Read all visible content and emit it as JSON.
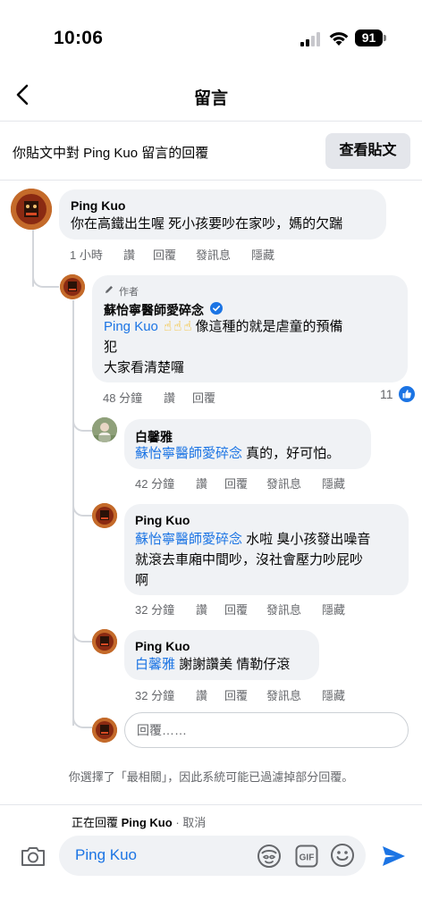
{
  "status": {
    "time": "10:06",
    "battery": "91"
  },
  "header": {
    "title": "留言"
  },
  "context": {
    "text": "你貼文中對 Ping Kuo 留言的回覆",
    "view_post": "查看貼文"
  },
  "comments": {
    "c1": {
      "name": "Ping Kuo",
      "text": "你在高鐵出生喔 死小孩要吵在家吵，媽的欠踹",
      "time": "1 小時",
      "like": "讚",
      "reply": "回覆",
      "message": "發訊息",
      "hide": "隱藏"
    },
    "c2": {
      "badge": "作者",
      "name": "蘇怡寧醫師愛碎念",
      "mention": "Ping Kuo",
      "emoji": "☝☝☝",
      "text_a": "像這種的就是虐童的預備",
      "text_b": "犯",
      "text_c": "大家看清楚囉",
      "time": "48 分鐘",
      "like": "讚",
      "reply": "回覆",
      "reactions": "11"
    },
    "c3": {
      "name": "白馨雅",
      "mention": "蘇怡寧醫師愛碎念",
      "text": " 真的，好可怕。",
      "time": "42 分鐘",
      "like": "讚",
      "reply": "回覆",
      "message": "發訊息",
      "hide": "隱藏"
    },
    "c4": {
      "name": "Ping Kuo",
      "mention": "蘇怡寧醫師愛碎念",
      "text_a": " 水啦 臭小孩發出噪音",
      "text_b": "就滾去車廂中間吵，沒社會壓力吵屁吵",
      "text_c": "啊",
      "time": "32 分鐘",
      "like": "讚",
      "reply": "回覆",
      "message": "發訊息",
      "hide": "隱藏"
    },
    "c5": {
      "name": "Ping Kuo",
      "mention": "白馨雅",
      "text": " 謝謝讚美 情勒仔滾",
      "time": "32 分鐘",
      "like": "讚",
      "reply": "回覆",
      "message": "發訊息",
      "hide": "隱藏"
    }
  },
  "reply_box": {
    "placeholder": "回覆……"
  },
  "notice": "你選擇了「最相關」，因此系統可能已過濾掉部分回覆。",
  "composer": {
    "replying_prefix": "正在回覆",
    "replying_name": "Ping Kuo",
    "cancel": "· 取消",
    "text": "Ping Kuo"
  },
  "icons": [
    "back-icon",
    "signal-icon",
    "wifi-icon",
    "battery-icon",
    "pencil-icon",
    "verified-icon",
    "like-reaction-icon",
    "camera-icon",
    "avatar-sticker-icon",
    "gif-icon",
    "emoji-icon",
    "send-icon"
  ],
  "colors": {
    "accent": "#1b74e4",
    "bubble": "#f0f2f5",
    "meta": "#65676b"
  }
}
